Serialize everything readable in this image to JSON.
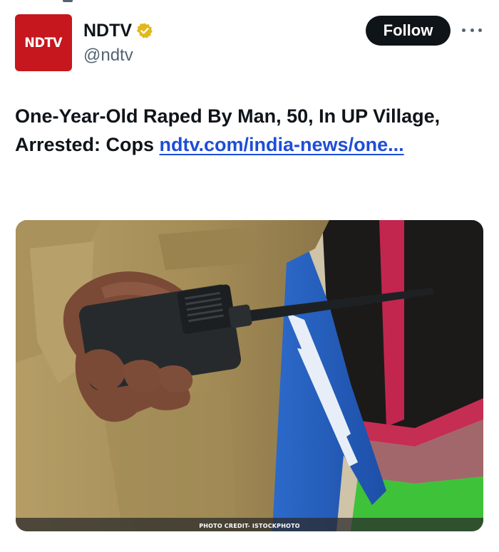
{
  "account": {
    "logo_text": "NDTV",
    "display_name": "NDTV",
    "handle": "@ndtv",
    "verified_badge": "gold-verified-badge-icon"
  },
  "actions": {
    "follow_label": "Follow",
    "more_icon": "more-horizontal-icon"
  },
  "tweet": {
    "text": "One-Year-Old Raped By Man, 50, In UP Village, Arrested: Cops ",
    "link_text": "ndtv.com/india-news/one..."
  },
  "media": {
    "photo_credit": "PHOTO CREDIT- ISTOCKPHOTO"
  },
  "colors": {
    "brand_red": "#c5171d",
    "link_blue": "#1d4ed8",
    "follow_bg": "#0f1419",
    "verified_gold": "#e2b719"
  }
}
